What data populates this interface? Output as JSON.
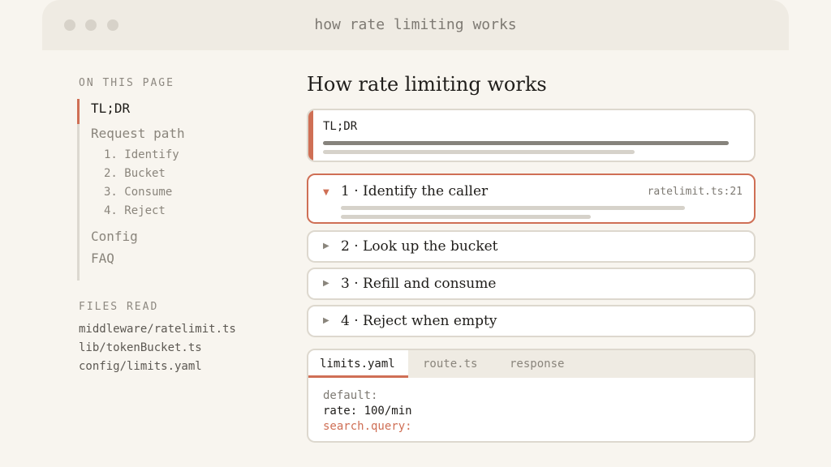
{
  "window": {
    "title": "how rate limiting works"
  },
  "sidebar": {
    "on_this_page_heading": "ON THIS PAGE",
    "items": [
      {
        "label": "TL;DR"
      },
      {
        "label": "Request path"
      },
      {
        "label": "Config"
      },
      {
        "label": "FAQ"
      }
    ],
    "sub_items": [
      {
        "label": "1. Identify"
      },
      {
        "label": "2. Bucket"
      },
      {
        "label": "3. Consume"
      },
      {
        "label": "4. Reject"
      }
    ],
    "files_heading": "FILES READ",
    "files": [
      "middleware/ratelimit.ts",
      "lib/tokenBucket.ts",
      "config/limits.yaml"
    ]
  },
  "main": {
    "title": "How rate limiting works",
    "tldr": {
      "label": "TL;DR"
    },
    "steps": [
      {
        "label": "1 · Identify the caller",
        "ref": "ratelimit.ts:21",
        "expanded": true
      },
      {
        "label": "2 · Look up the bucket",
        "expanded": false
      },
      {
        "label": "3 · Refill and consume",
        "expanded": false
      },
      {
        "label": "4 · Reject when empty",
        "expanded": false
      }
    ],
    "code_panel": {
      "tabs": [
        "limits.yaml",
        "route.ts",
        "response"
      ],
      "active_tab": "limits.yaml",
      "lines": [
        "default:",
        "rate: 100/min",
        "search.query:"
      ]
    }
  },
  "colors": {
    "accent": "#cf6f55",
    "background": "#f8f5ef",
    "titlebar": "#efebe3",
    "border": "#ddd8ce"
  },
  "icons": {
    "expanded": "caret-down-icon",
    "collapsed": "caret-right-icon"
  }
}
